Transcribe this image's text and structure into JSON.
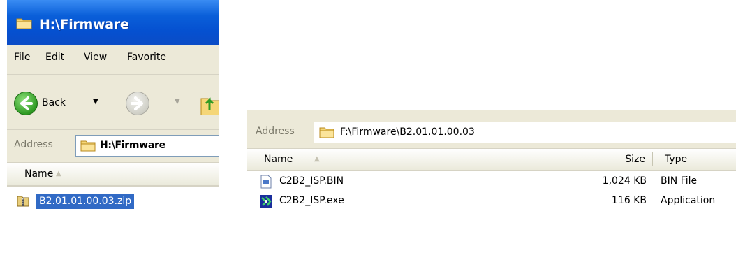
{
  "left_window": {
    "title": "H:\\Firmware",
    "menu": [
      {
        "u": "F",
        "rest": "ile"
      },
      {
        "u": "E",
        "rest": "dit"
      },
      {
        "u": "V",
        "rest": "iew"
      },
      {
        "pre": "F",
        "u": "a",
        "rest": "vorite"
      }
    ],
    "toolbar": {
      "back_label": "Back"
    },
    "address": {
      "label": "Address",
      "value": "H:\\Firmware"
    },
    "columns": {
      "name": "Name"
    },
    "files": [
      {
        "name": "B2.01.01.00.03.zip",
        "selected": true
      }
    ]
  },
  "right_window": {
    "address": {
      "label": "Address",
      "value": "F:\\Firmware\\B2.01.01.00.03"
    },
    "columns": {
      "name": "Name",
      "size": "Size",
      "type": "Type"
    },
    "files": [
      {
        "name": "C2B2_ISP.BIN",
        "size": "1,024 KB",
        "type": "BIN File",
        "icon": "bin-file-icon"
      },
      {
        "name": "C2B2_ISP.exe",
        "size": "116 KB",
        "type": "Application",
        "icon": "application-icon"
      }
    ]
  },
  "colors": {
    "selection": "#316ac5",
    "titlebar": "#0a5fd9",
    "chrome": "#ece9d8"
  }
}
